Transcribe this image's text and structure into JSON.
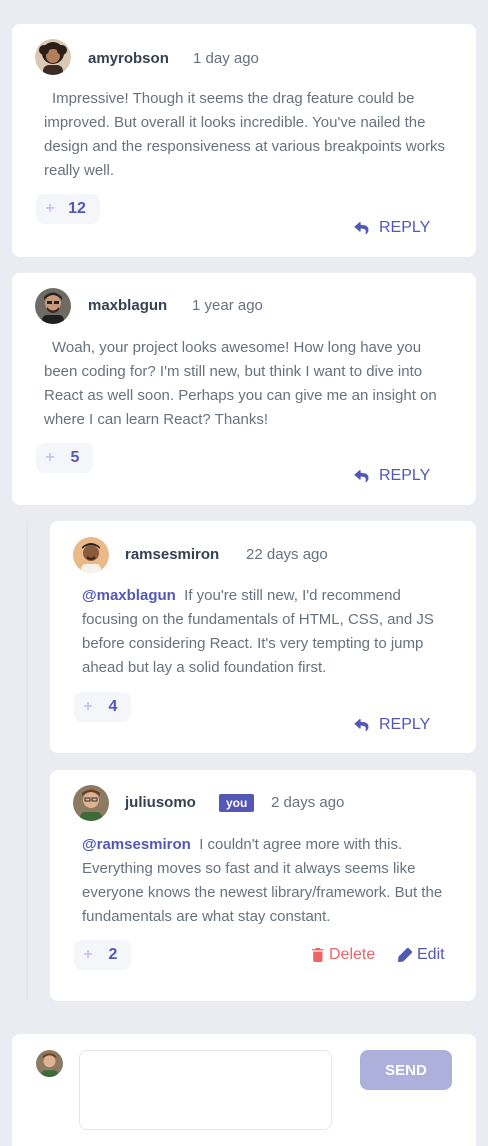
{
  "colors": {
    "background": "#eaecf1",
    "card": "#ffffff",
    "accent": "#5357b6",
    "accent_light": "#c5c6ef",
    "delete": "#ed6468",
    "name": "#334253",
    "text": "#67727e"
  },
  "comments": [
    {
      "username": "amyrobson",
      "time": "1 day ago",
      "content": "Impressive! Though it seems the drag feature could be improved. But overall it looks incredible. You've nailed the design and the responsiveness at various breakpoints works really well.",
      "score": "12",
      "reply_label": "REPLY"
    },
    {
      "username": "maxblagun",
      "time": "1 year ago",
      "content": "Woah, your project looks awesome! How long have you been coding for? I'm still new, but think I want to dive into React as well soon. Perhaps you can give me an insight on where I can learn React? Thanks!",
      "score": "5",
      "reply_label": "REPLY"
    }
  ],
  "replies": [
    {
      "username": "ramsesmiron",
      "time": "22 days ago",
      "mention": "@maxblagun",
      "content": "If you're still new, I'd recommend focusing on the fundamentals of HTML, CSS, and JS before considering React. It's very tempting to jump ahead but lay a solid foundation first.",
      "score": "4",
      "reply_label": "REPLY"
    },
    {
      "username": "juliusomo",
      "you_badge": "you",
      "time": "2 days ago",
      "mention": "@ramsesmiron",
      "content": "I couldn't agree more with this. Everything moves so fast and it always seems like everyone knows the newest library/framework. But the fundamentals are what stay constant.",
      "score": "2",
      "delete_label": "Delete",
      "edit_label": "Edit"
    }
  ],
  "composer": {
    "placeholder": "",
    "send_label": "SEND"
  }
}
